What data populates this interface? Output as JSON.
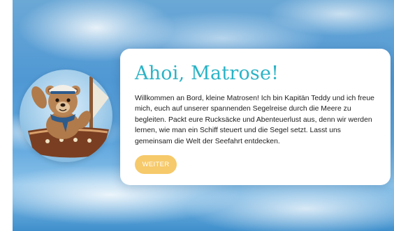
{
  "hero": {
    "image_icon": "teddy-captain-illustration",
    "title": "Ahoi, Matrose!",
    "text": "Willkommen an Bord, kleine Matrosen! Ich bin Kapitän Teddy und ich freue mich, euch auf unserer spannenden Segelreise durch die Meere zu begleiten. Packt eure Rucksäcke und Abenteuerlust aus, denn wir werden lernen, wie man ein Schiff steuert und die Segel setzt. Lasst uns gemeinsam die Welt der Seefahrt entdecken.",
    "button_label": "WEITER"
  },
  "colors": {
    "title": "#2ab3c6",
    "button": "#f6c96b",
    "card": "#ffffff",
    "sky": "#4f98d4"
  }
}
